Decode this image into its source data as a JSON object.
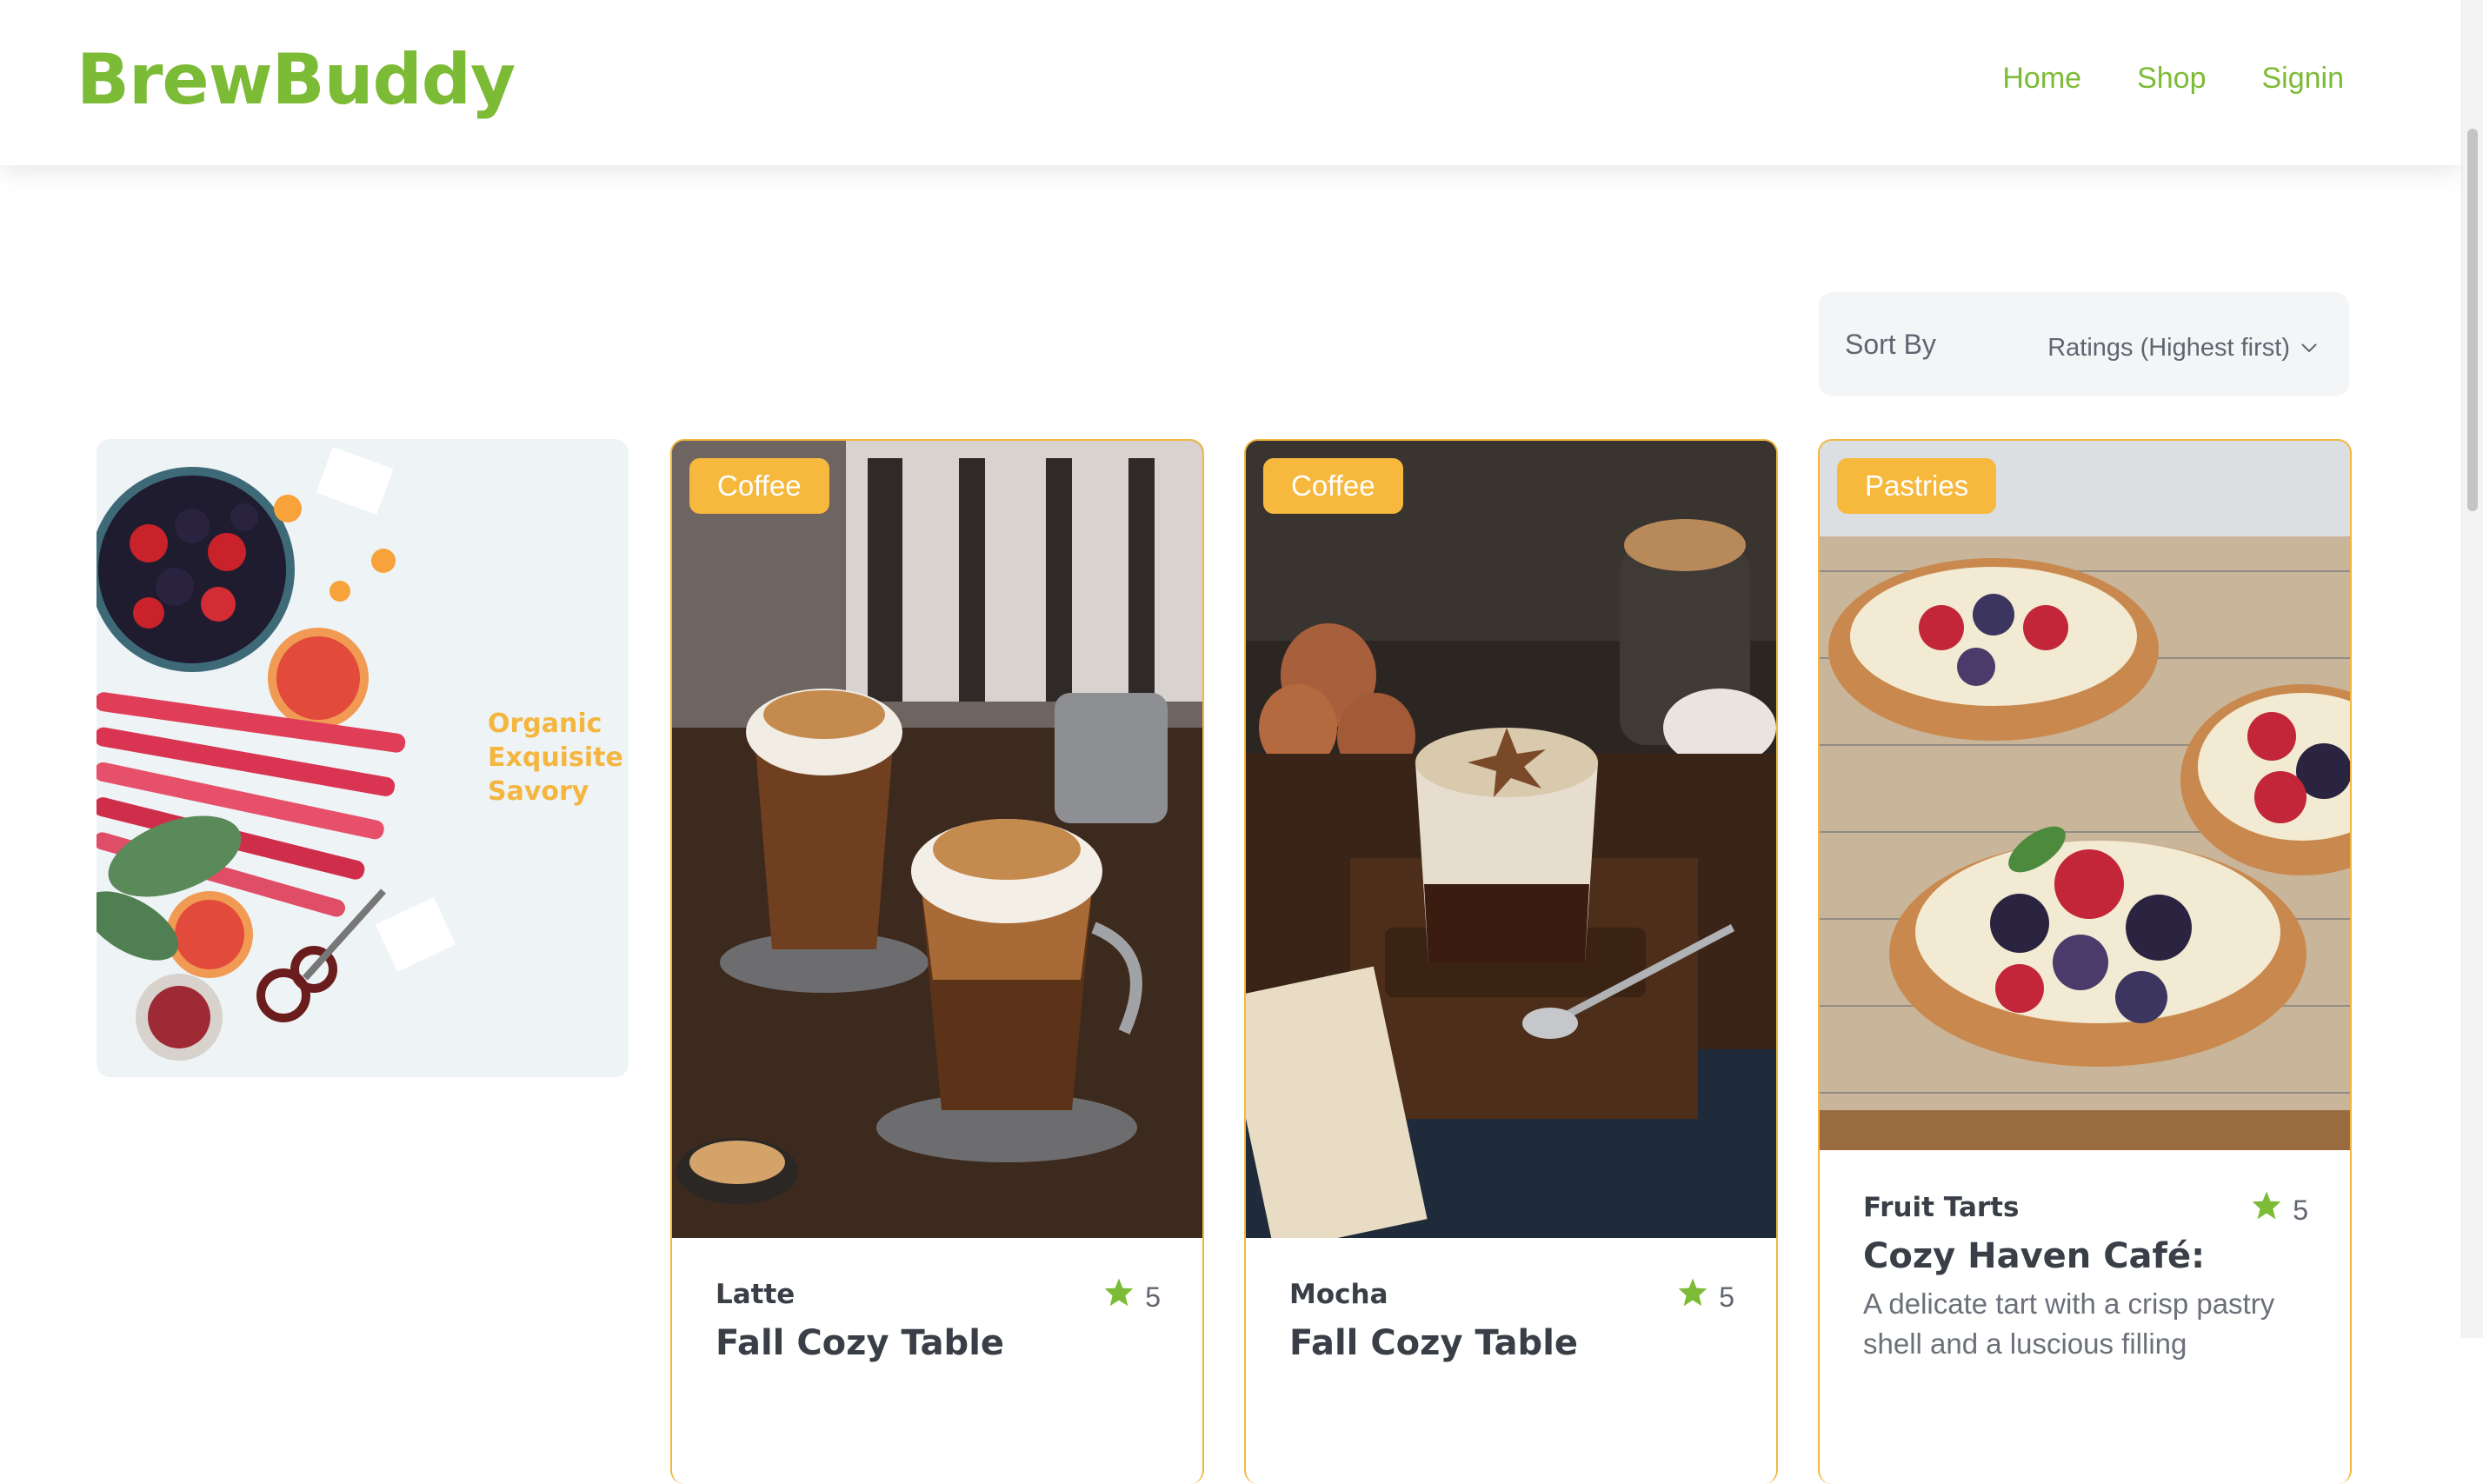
{
  "header": {
    "logo": "BrewBuddy",
    "nav": [
      {
        "label": "Home"
      },
      {
        "label": "Shop"
      },
      {
        "label": "Signin"
      }
    ]
  },
  "sort": {
    "label": "Sort By",
    "selected": "Ratings (Highest first)"
  },
  "promo": {
    "lines": [
      "Organic",
      "Exquisite",
      "Savory"
    ]
  },
  "products": [
    {
      "category": "Coffee",
      "name": "Latte",
      "rating": "5",
      "subtitle": "Fall Cozy Table"
    },
    {
      "category": "Coffee",
      "name": "Mocha",
      "rating": "5",
      "subtitle": "Fall Cozy Table"
    },
    {
      "category": "Pastries",
      "name": "Fruit Tarts",
      "rating": "5",
      "subtitle": "Cozy Haven Café:",
      "description": "A delicate tart with a crisp pastry shell and a luscious filling"
    }
  ],
  "colors": {
    "brand": "#7cbb35",
    "badge": "#f6b83d",
    "card_border": "#f4b63f",
    "text_dark": "#3a3f47",
    "text_muted": "#5f6670"
  },
  "icons": {
    "rating": "star-icon",
    "sort": "chevron-down-icon"
  }
}
